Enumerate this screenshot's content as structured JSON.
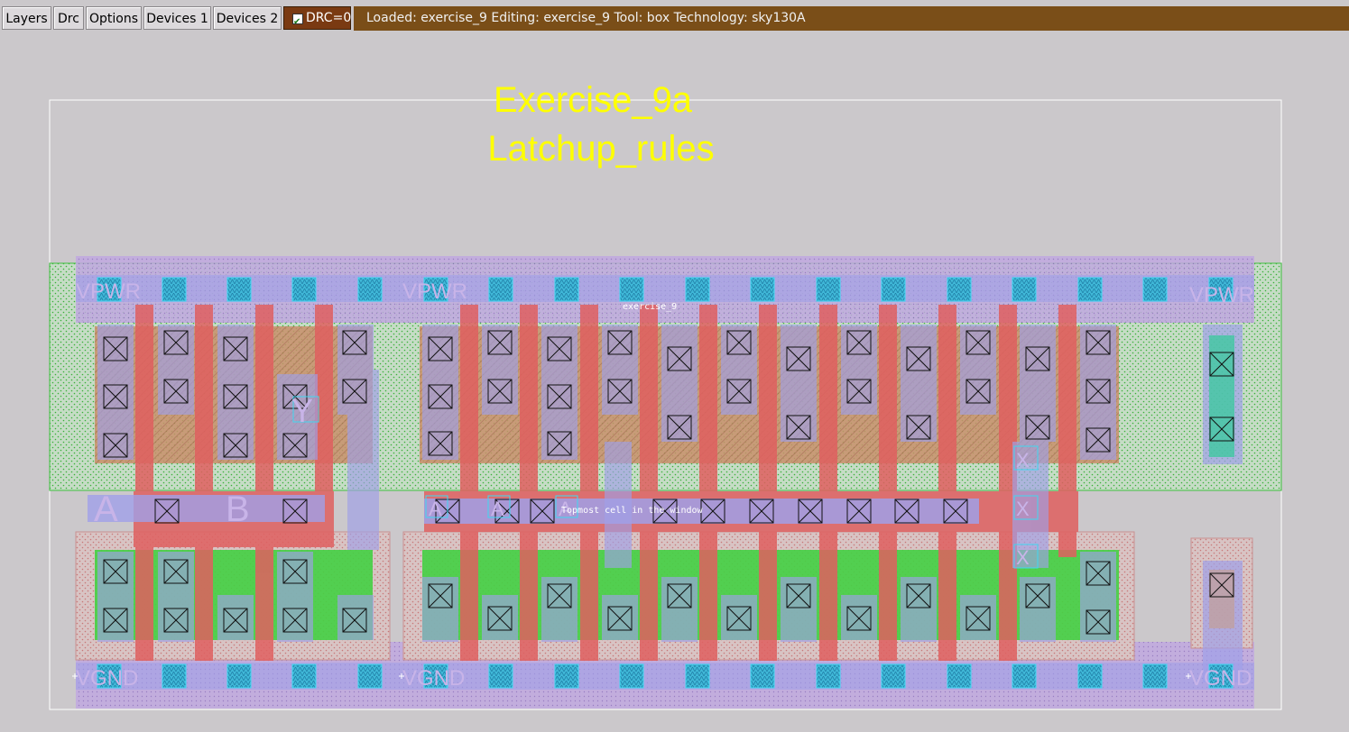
{
  "menu": {
    "layers": "Layers",
    "drc": "Drc",
    "options": "Options",
    "devices1": "Devices 1",
    "devices2": "Devices 2"
  },
  "drc_toggle": {
    "label": "DRC=0",
    "checked": true
  },
  "status_bar": {
    "text": "Loaded: exercise_9 Editing: exercise_9 Tool: box  Technology: sky130A"
  },
  "layout": {
    "title_line1": "Exercise_9a",
    "title_line2": "Latchup_rules",
    "cell_name": "exercise_9",
    "topmost_label": "Topmost cell in the window",
    "port_labels": {
      "vpwr": "VPWR",
      "vgnd": "VGND",
      "a": "A",
      "b": "B",
      "y": "Y",
      "x": "X"
    }
  },
  "colors": {
    "status_bg": "#7a4e18",
    "drc_bg": "#7a3a12",
    "title_yellow": "#ffff00",
    "poly_red": "#e06060",
    "metal_purple": "#a0a0e8",
    "nwell_green": "#3ad03a",
    "contact_cyan": "#40c8e0"
  }
}
